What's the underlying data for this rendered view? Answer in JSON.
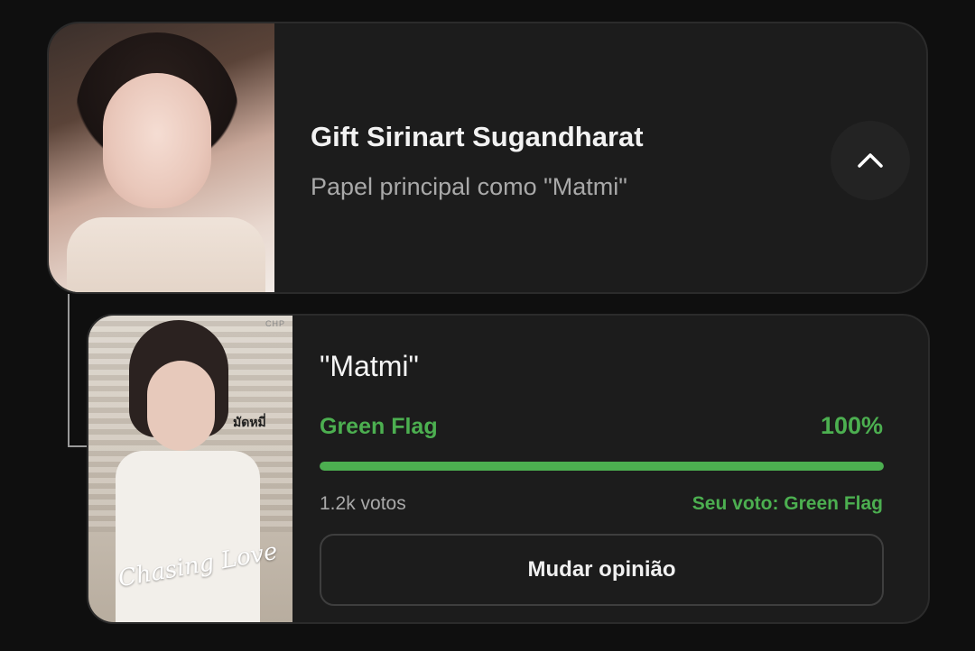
{
  "actor": {
    "name": "Gift Sirinart Sugandharat",
    "role": "Papel principal como \"Matmi\"",
    "collapse_icon": "chevron-up-icon"
  },
  "character": {
    "name": "\"Matmi\"",
    "poster": {
      "thai_text": "มัดหมี่",
      "brand_text": "CHP",
      "title_text": "Chasing Love"
    },
    "flag_label": "Green Flag",
    "percent_label": "100%",
    "percent_value": 100,
    "votes_label": "1.2k votos",
    "my_vote_label": "Seu voto: Green Flag",
    "change_button_label": "Mudar opinião"
  },
  "colors": {
    "accent_green": "#4caf50",
    "card_background": "#1c1c1c",
    "page_background": "#0f0f0f"
  }
}
